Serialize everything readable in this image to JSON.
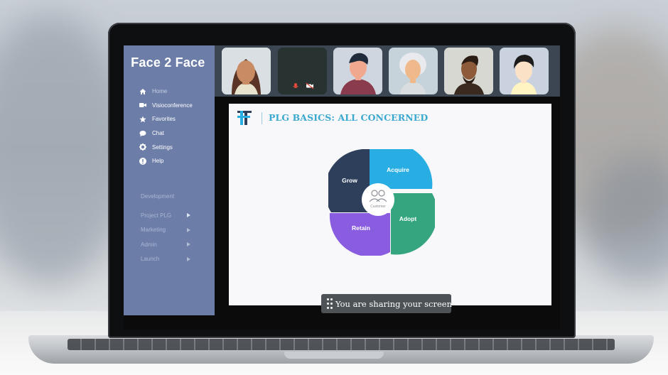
{
  "app": {
    "logo_text": "Face 2 Face"
  },
  "sidebar": {
    "nav": [
      {
        "label": "Home",
        "icon": "home-icon",
        "active": false
      },
      {
        "label": "Visioconference",
        "icon": "video-camera-icon",
        "active": true
      },
      {
        "label": "Favorites",
        "icon": "star-icon",
        "active": true
      },
      {
        "label": "Chat",
        "icon": "chat-bubble-icon",
        "active": true
      },
      {
        "label": "Settings",
        "icon": "gear-icon",
        "active": true
      },
      {
        "label": "Help",
        "icon": "info-icon",
        "active": true
      }
    ],
    "section_label": "Development",
    "groups": [
      {
        "label": "Project PLG"
      },
      {
        "label": "Marketing"
      },
      {
        "label": "Admin"
      },
      {
        "label": "Launch"
      }
    ]
  },
  "participants": [
    {
      "name": "participant-1",
      "kind": "avatar"
    },
    {
      "name": "participant-2",
      "kind": "camera-off",
      "icons": [
        "microphone-icon",
        "camera-off-icon"
      ]
    },
    {
      "name": "participant-3",
      "kind": "avatar"
    },
    {
      "name": "participant-4",
      "kind": "avatar"
    },
    {
      "name": "participant-5",
      "kind": "avatar"
    },
    {
      "name": "participant-6",
      "kind": "avatar"
    }
  ],
  "slide": {
    "title": "PLG BASICS: ALL CONCERNED",
    "center_label": "Customer",
    "segments": [
      {
        "label": "Acquire",
        "color": "#29aee3"
      },
      {
        "label": "Adopt",
        "color": "#35a57f"
      },
      {
        "label": "Retain",
        "color": "#8a5ce0"
      },
      {
        "label": "Grow",
        "color": "#2e3f5c"
      }
    ]
  },
  "share_status": {
    "text": "You are sharing your screen"
  },
  "colors": {
    "sidebar": "#6c7ea8",
    "strip": "#3c4653",
    "title_accent": "#3aa8cf"
  }
}
